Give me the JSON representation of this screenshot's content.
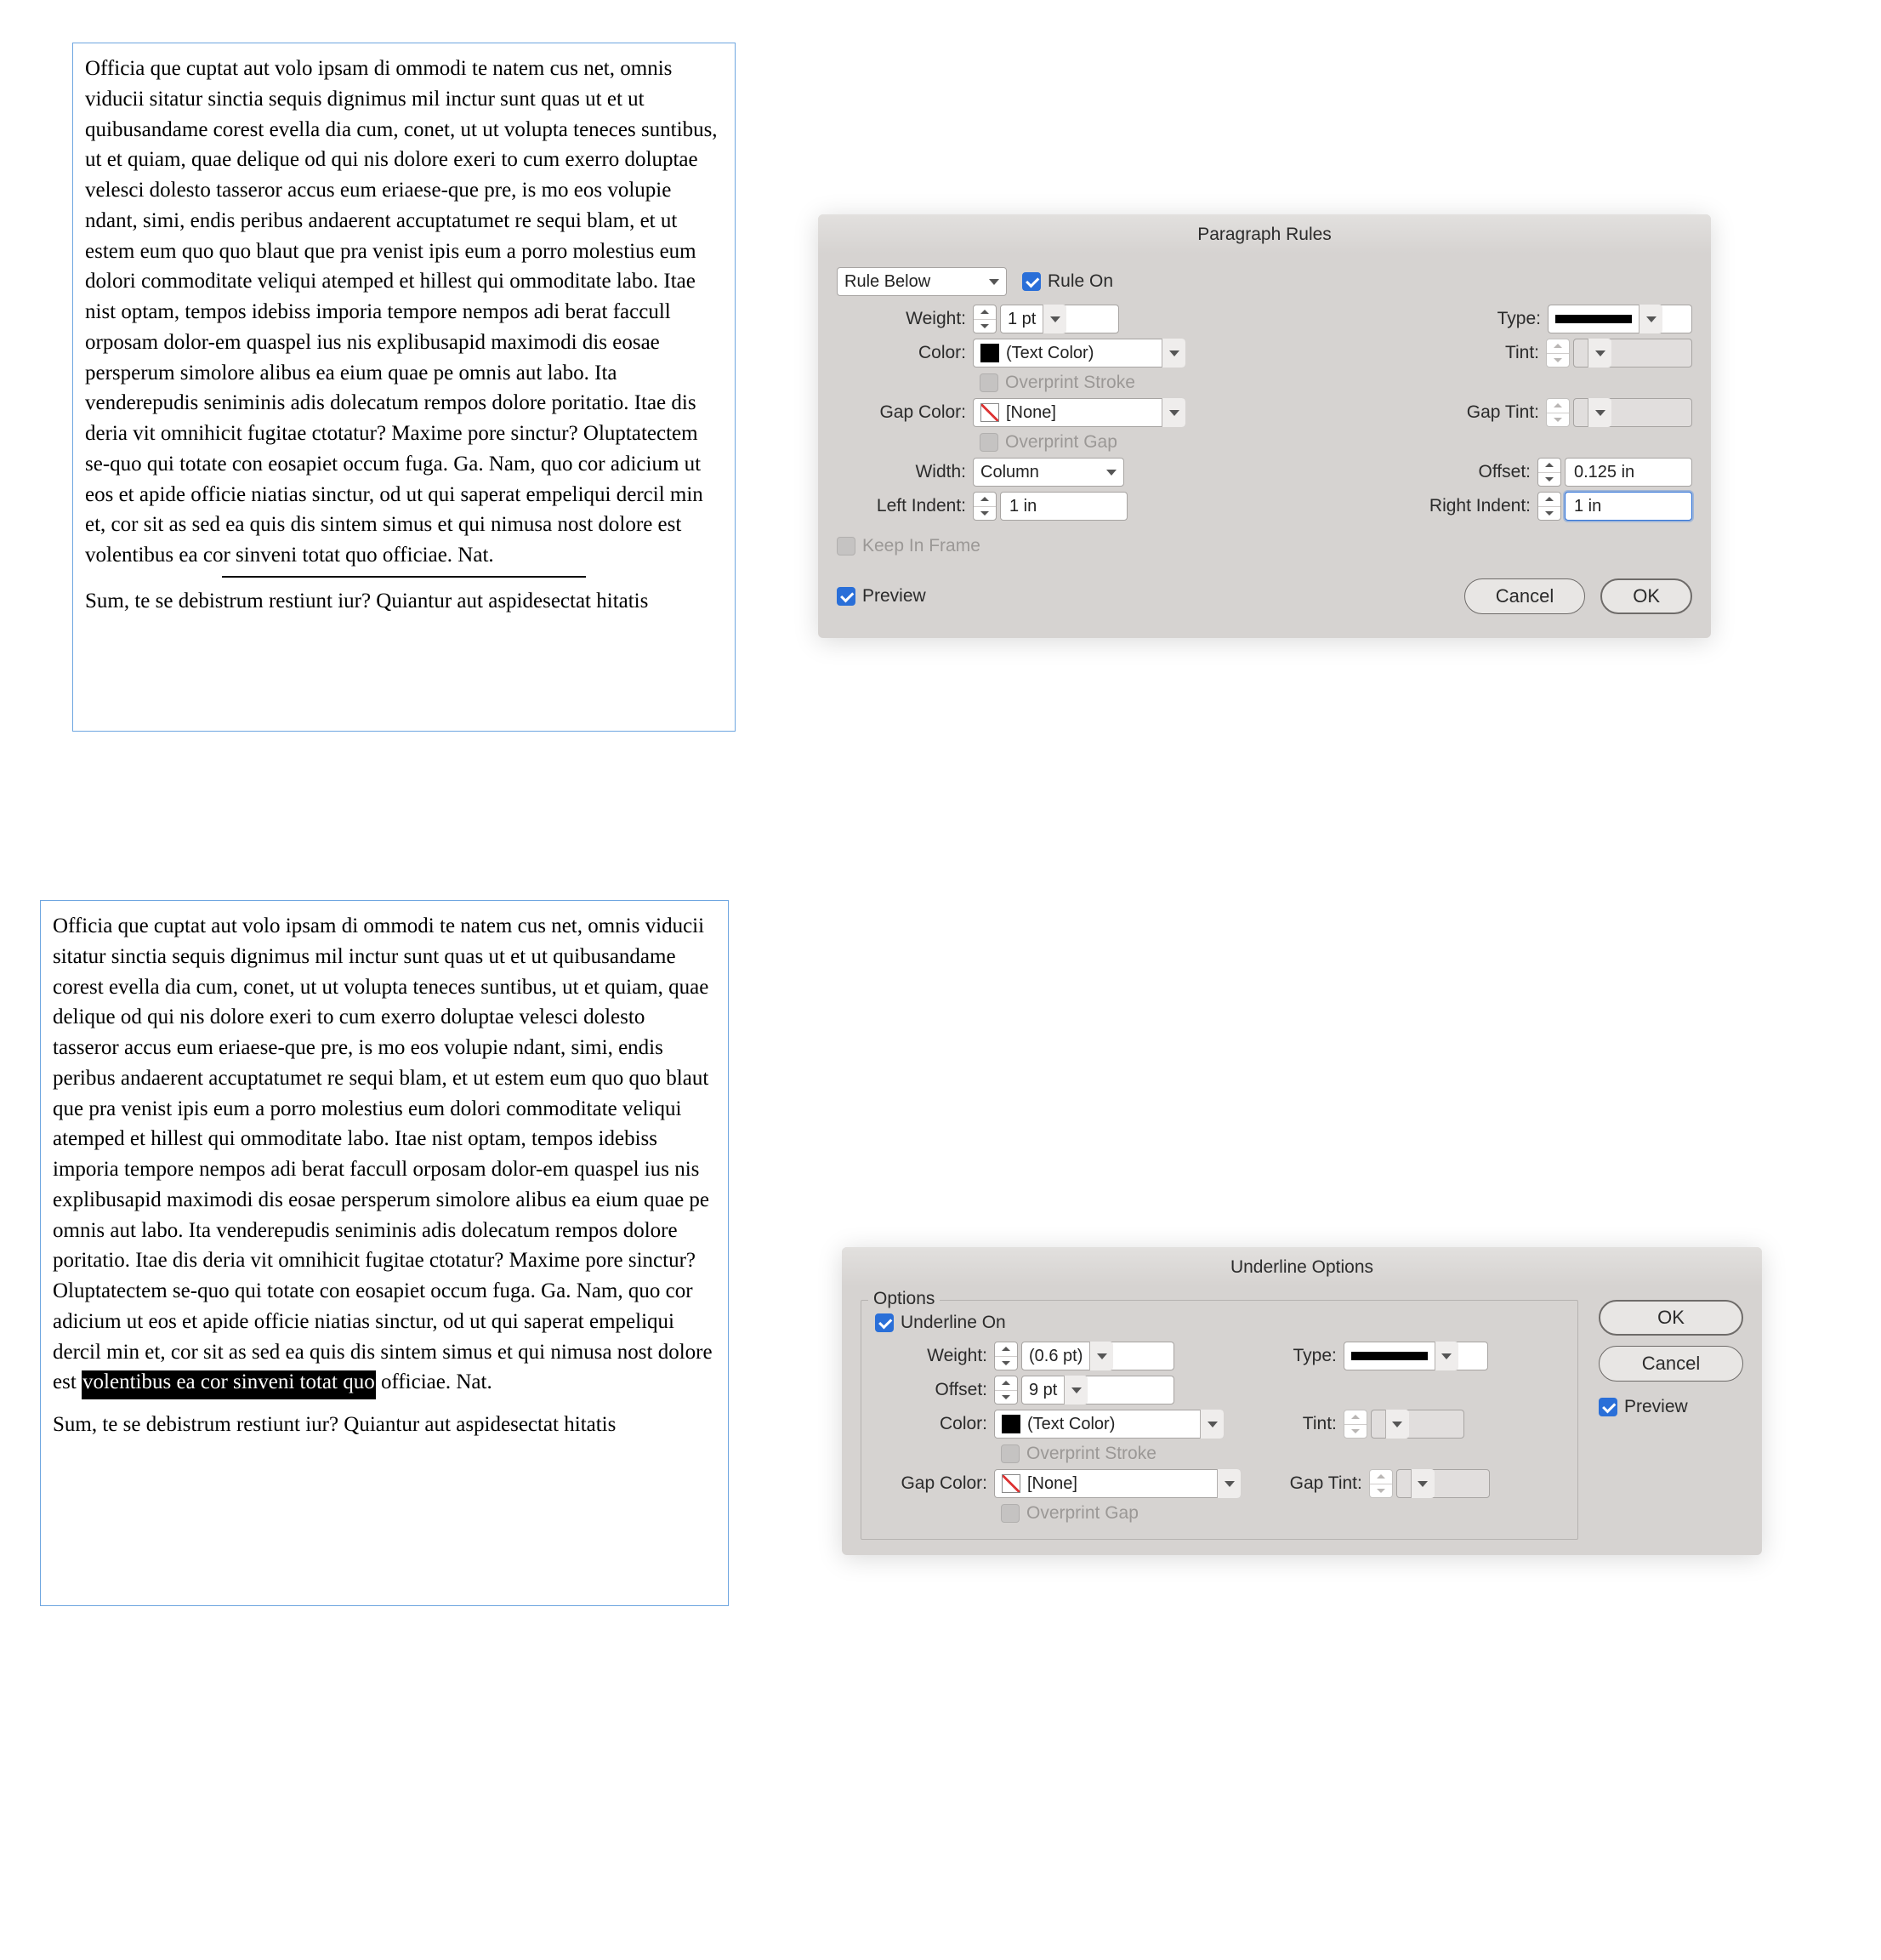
{
  "frame1": {
    "body": "Officia que cuptat aut volo ipsam di ommodi te natem cus net, omnis viducii sitatur sinctia sequis dignimus mil inctur sunt quas ut et ut quibusandame corest evella dia cum, conet, ut ut volupta teneces suntibus, ut et quiam, quae delique od qui nis dolore exeri to cum exerro doluptae velesci dolesto tasseror accus eum eriaese-que pre, is mo eos volupie ndant, simi, endis peribus andaerent accuptatumet re sequi blam, et ut estem eum quo quo blaut que pra venist ipis eum a porro molestius eum dolori commoditate veliqui atemped et hillest qui ommoditate labo. Itae nist optam, tempos idebiss imporia tempore nempos adi berat faccull orposam dolor-em quaspel ius nis explibusapid maximodi dis eosae persperum simolore alibus ea eium quae pe omnis aut labo. Ita venderepudis seniminis adis dolecatum rempos dolore poritatio. Itae dis deria vit omnihicit fugitae ctotatur? Maxime pore sinctur? Oluptatectem se-quo qui totate con eosapiet occum fuga. Ga. Nam, quo cor adicium ut eos et apide officie niatias sinctur, od ut qui saperat empeliqui dercil min et, cor sit as sed ea quis dis sintem simus et qui nimusa nost dolore est volentibus ea cor sinveni totat quo officiae. Nat.",
    "after": "Sum, te se debistrum restiunt iur? Quiantur aut aspidesectat hitatis"
  },
  "frame2": {
    "pre": "Officia que cuptat aut volo ipsam di ommodi te natem cus net, omnis viducii sitatur sinctia sequis dignimus mil inctur sunt quas ut et ut quibusandame corest evella dia cum, conet, ut ut volupta teneces suntibus, ut et quiam, quae delique od qui nis dolore exeri to cum exerro doluptae velesci dolesto tasseror accus eum eriaese-que pre, is mo eos volupie ndant, simi, endis peribus andaerent accuptatumet re sequi blam, et ut estem eum quo quo blaut que pra venist ipis eum a porro molestius eum dolori commoditate veliqui atemped et hillest qui ommoditate labo. Itae nist optam, tempos idebiss imporia tempore nempos adi berat faccull orposam dolor-em quaspel ius nis explibusapid maximodi dis eosae persperum simolore alibus ea eium quae pe omnis aut labo. Ita venderepudis seniminis adis dolecatum rempos dolore poritatio. Itae dis deria vit omnihicit fugitae ctotatur? Maxime pore sinctur? Oluptatectem se-quo qui totate con eosapiet occum fuga. Ga. Nam, quo cor adicium ut eos et apide officie niatias sinctur, od ut qui saperat empeliqui dercil min et, cor sit as sed ea quis dis sintem simus et qui nimusa nost dolore est ",
    "sel": "volentibus ea cor sinveni totat quo",
    "post": " officiae. Nat.",
    "after": "Sum, te se debistrum restiunt iur? Quiantur aut aspidesectat hitatis"
  },
  "pr": {
    "title": "Paragraph Rules",
    "rule_select": "Rule Below",
    "rule_on": "Rule On",
    "labels": {
      "weight": "Weight:",
      "type": "Type:",
      "color": "Color:",
      "tint": "Tint:",
      "overprint_stroke": "Overprint Stroke",
      "gap_color": "Gap Color:",
      "gap_tint": "Gap Tint:",
      "overprint_gap": "Overprint Gap",
      "width": "Width:",
      "offset": "Offset:",
      "left_indent": "Left Indent:",
      "right_indent": "Right Indent:",
      "keep_in_frame": "Keep In Frame",
      "preview": "Preview",
      "cancel": "Cancel",
      "ok": "OK"
    },
    "values": {
      "weight": "1 pt",
      "color": "(Text Color)",
      "gap_color": "[None]",
      "width": "Column",
      "offset": "0.125 in",
      "left_indent": "1 in",
      "right_indent": "1 in"
    }
  },
  "uo": {
    "title": "Underline Options",
    "options_legend": "Options",
    "labels": {
      "underline_on": "Underline On",
      "weight": "Weight:",
      "type": "Type:",
      "offset": "Offset:",
      "color": "Color:",
      "tint": "Tint:",
      "overprint_stroke": "Overprint Stroke",
      "gap_color": "Gap Color:",
      "gap_tint": "Gap Tint:",
      "overprint_gap": "Overprint Gap",
      "ok": "OK",
      "cancel": "Cancel",
      "preview": "Preview"
    },
    "values": {
      "weight": "(0.6 pt)",
      "offset": "9 pt",
      "color": "(Text Color)",
      "gap_color": "[None]"
    }
  }
}
